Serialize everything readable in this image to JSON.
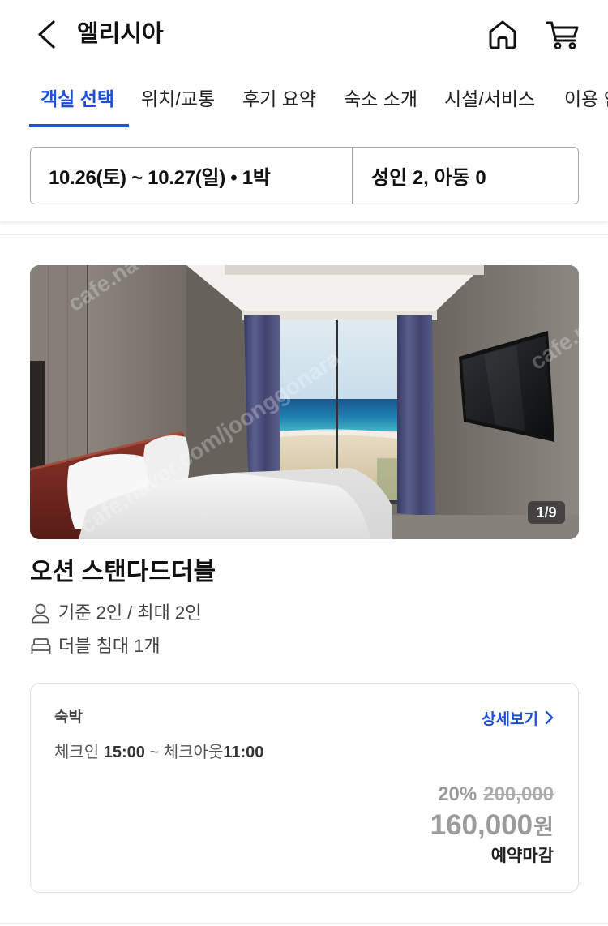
{
  "header": {
    "title": "엘리시아",
    "icons": {
      "back": "chevron-left-icon",
      "home": "home-icon",
      "cart": "cart-icon"
    }
  },
  "tabs": [
    {
      "label": "객실 선택",
      "active": true
    },
    {
      "label": "위치/교통",
      "active": false
    },
    {
      "label": "후기 요약",
      "active": false
    },
    {
      "label": "숙소 소개",
      "active": false
    },
    {
      "label": "시설/서비스",
      "active": false
    },
    {
      "label": "이용 안내",
      "active": false
    }
  ],
  "search": {
    "dates": "10.26(토) ~ 10.27(일) • 1박",
    "guests": "성인 2, 아동 0"
  },
  "room": {
    "photo": {
      "counter": "1/9",
      "watermark": "cafe.naver.com/joonggonara"
    },
    "name": "오션 스탠다드더블",
    "capacity": {
      "icon": "person-icon",
      "text": "기준 2인 / 최대 2인"
    },
    "bed": {
      "icon": "bed-icon",
      "text": "더블 침대 1개"
    }
  },
  "stay_option": {
    "type": "숙박",
    "detail_link": {
      "label": "상세보기",
      "icon": "chevron-right-icon"
    },
    "check_in_label": "체크인",
    "check_in_time": "15:00",
    "time_separator": "~",
    "check_out_label": "체크아웃",
    "check_out_time": "11:00",
    "discount_rate": "20%",
    "original_price": "200,000",
    "sale_price": "160,000",
    "currency": "원",
    "status": "예약마감"
  },
  "colors": {
    "accent": "#1c50d8",
    "text": "#111111",
    "secondary_text": "#444444",
    "unavailable_price": "#9e9e9e",
    "border": "#dedede"
  }
}
